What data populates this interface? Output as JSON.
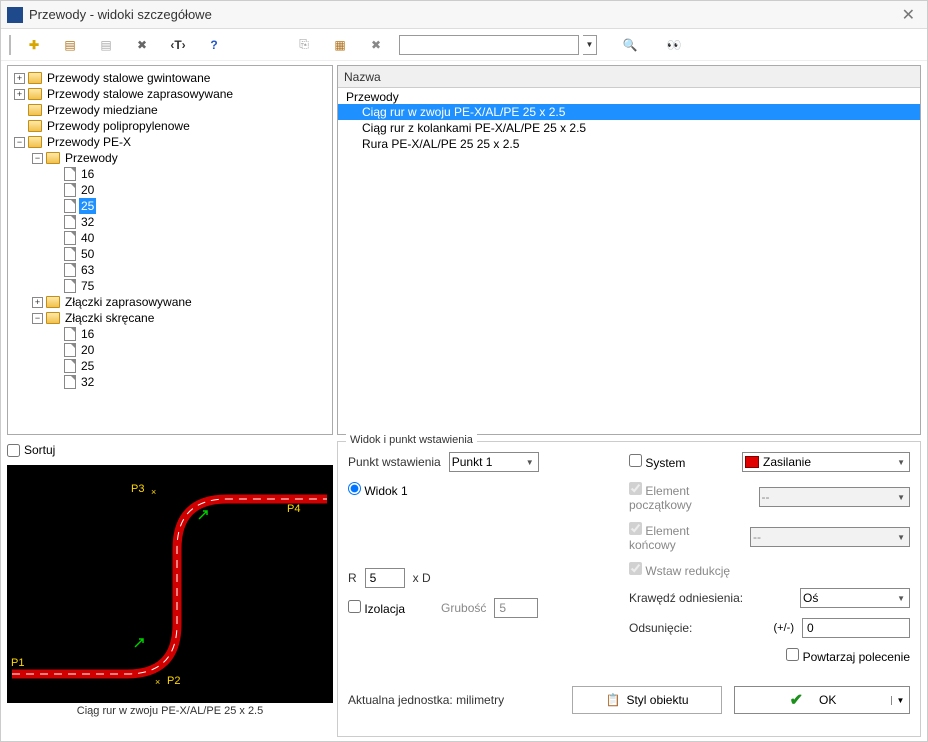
{
  "window": {
    "title": "Przewody - widoki szczegółowe"
  },
  "tree": {
    "items": [
      {
        "label": "Przewody stalowe gwintowane"
      },
      {
        "label": "Przewody stalowe zaprasowywane"
      },
      {
        "label": "Przewody miedziane"
      },
      {
        "label": "Przewody polipropylenowe"
      },
      {
        "label": "Przewody PE-X"
      }
    ],
    "pex_children": {
      "przewody": {
        "label": "Przewody",
        "sizes": [
          "16",
          "20",
          "25",
          "32",
          "40",
          "50",
          "63",
          "75"
        ],
        "selected": "25"
      },
      "zlaczki_zapras": {
        "label": "Złączki zaprasowywane"
      },
      "zlaczki_skrec": {
        "label": "Złączki skręcane",
        "sizes": [
          "16",
          "20",
          "25",
          "32"
        ]
      }
    }
  },
  "list": {
    "header": "Nazwa",
    "group": "Przewody",
    "items": [
      "Ciąg rur w zwoju PE-X/AL/PE 25 x 2.5",
      "Ciąg rur z kolankami PE-X/AL/PE 25 x 2.5",
      "Rura PE-X/AL/PE 25 25 x 2.5"
    ],
    "selected_index": 0
  },
  "sort": {
    "label": "Sortuj"
  },
  "preview": {
    "caption": "Ciąg rur w zwoju PE-X/AL/PE 25 x 2.5",
    "points": [
      "P1",
      "P2",
      "P3",
      "P4"
    ]
  },
  "opts": {
    "legend": "Widok i punkt wstawienia",
    "insert_label": "Punkt wstawienia",
    "insert_value": "Punkt 1",
    "view1": "Widok 1",
    "r_label": "R",
    "r_value": "5",
    "r_suffix": "x D",
    "izol_label": "Izolacja",
    "grub_label": "Grubość",
    "grub_value": "5",
    "system_label": "System",
    "system_value": "Zasilanie",
    "el_pocz": "Element początkowy",
    "el_konc": "Element końcowy",
    "wstaw_red": "Wstaw redukcję",
    "krawedz_label": "Krawędź odniesienia:",
    "krawedz_value": "Oś",
    "odsun_label": "Odsunięcie:",
    "odsun_pm": "(+/-)",
    "odsun_value": "0",
    "powtarzaj": "Powtarzaj polecenie",
    "dash": "--",
    "unit_label": "Aktualna jednostka: milimetry",
    "styl_btn": "Styl obiektu",
    "ok": "OK"
  }
}
